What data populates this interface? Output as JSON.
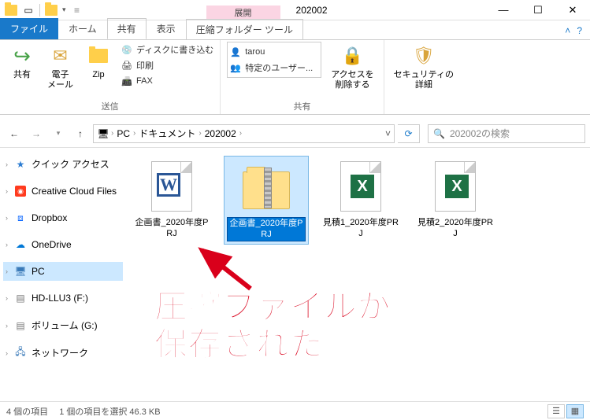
{
  "window": {
    "contextual_header": "展開",
    "contextual_tab": "圧縮フォルダー ツール",
    "title": "202002",
    "min": "—",
    "max": "☐",
    "close": "✕"
  },
  "tabs": {
    "file": "ファイル",
    "home": "ホーム",
    "share": "共有",
    "view": "表示"
  },
  "ribbon": {
    "group1": {
      "share": "共有",
      "mail": "電子\nメール",
      "zip": "Zip",
      "burn": "ディスクに書き込む",
      "print": "印刷",
      "fax": "FAX",
      "label": "送信"
    },
    "group2": {
      "user": "tarou",
      "specific": "特定のユーザー...",
      "remove": "アクセスを\n削除する",
      "label": "共有"
    },
    "group3": {
      "sec": "セキュリティの\n詳細",
      "label": ""
    }
  },
  "nav": {
    "pc": "PC",
    "docs": "ドキュメント",
    "folder": "202002",
    "search_placeholder": "202002の検索"
  },
  "navpane": {
    "quick": "クイック アクセス",
    "cc": "Creative Cloud Files",
    "dropbox": "Dropbox",
    "onedrive": "OneDrive",
    "pc": "PC",
    "hd": "HD-LLU3 (F:)",
    "vol": "ボリューム (G:)",
    "net": "ネットワーク"
  },
  "files": [
    {
      "name": "企画書_2020年度PRJ",
      "type": "word"
    },
    {
      "name": "企画書_2020年度PRJ",
      "type": "zip",
      "selected": true,
      "editing": true
    },
    {
      "name": "見積1_2020年度PRJ",
      "type": "excel"
    },
    {
      "name": "見積2_2020年度PRJ",
      "type": "excel"
    }
  ],
  "status": {
    "count": "4 個の項目",
    "sel": "1 個の項目を選択 46.3 KB"
  },
  "annotation": "圧縮ファイルが\n保存された"
}
